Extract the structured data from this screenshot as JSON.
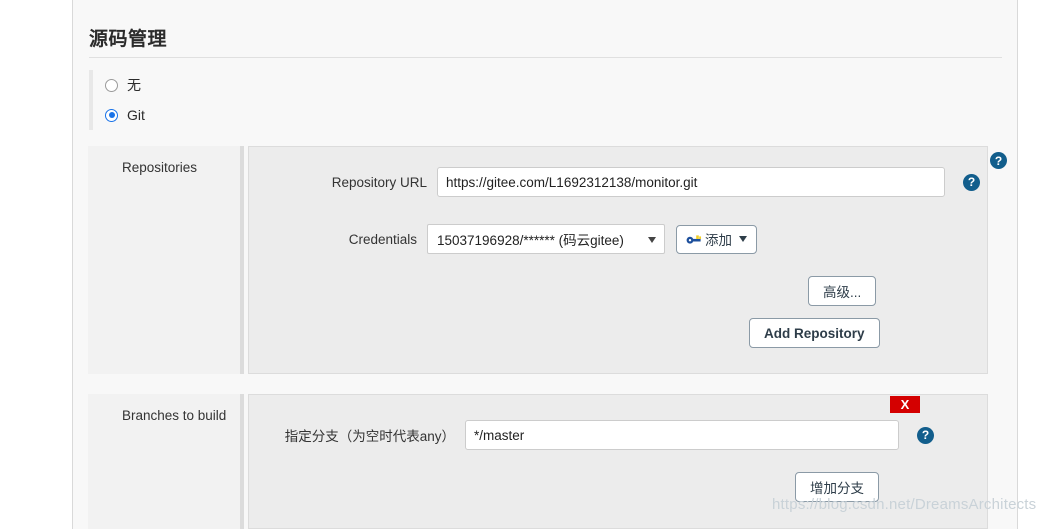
{
  "section": {
    "title": "源码管理"
  },
  "scm_options": [
    {
      "label": "无",
      "checked": false
    },
    {
      "label": "Git",
      "checked": true
    }
  ],
  "repositories": {
    "row_label": "Repositories",
    "repository_url": {
      "label": "Repository URL",
      "value": "https://gitee.com/L1692312138/monitor.git"
    },
    "credentials": {
      "label": "Credentials",
      "selected": "15037196928/****** (码云gitee)",
      "add_button": "添加"
    },
    "advanced_button": "高级...",
    "add_repository_button": "Add Repository"
  },
  "branches": {
    "row_label": "Branches to build",
    "branch_spec": {
      "label": "指定分支（为空时代表any）",
      "value": "*/master"
    },
    "delete_button": "X",
    "add_branch_button": "增加分支"
  },
  "help": {
    "glyph": "?"
  },
  "watermark": {
    "text": "https://blog.csdn.net/DreamsArchitects"
  },
  "colors": {
    "accent_blue": "#1a73e8",
    "help_blue": "#125e8c",
    "danger_red": "#d40000",
    "button_border": "#8b9aa6",
    "panel_bg": "#ececec",
    "page_bg": "#f8f8f8"
  }
}
